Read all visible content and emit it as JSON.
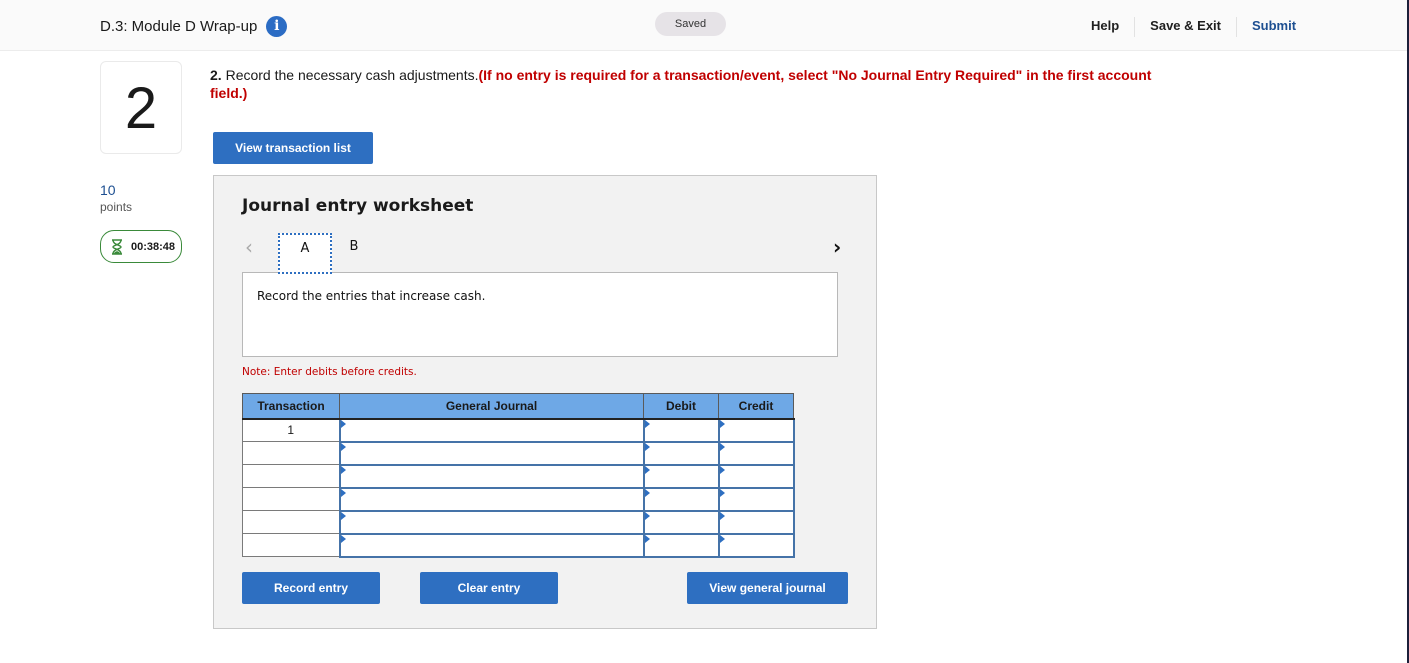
{
  "header": {
    "title": "D.3: Module D Wrap-up",
    "info_icon": "info-icon",
    "status": "Saved",
    "links": {
      "help": "Help",
      "save_exit": "Save & Exit",
      "submit": "Submit"
    }
  },
  "sidebar": {
    "question_number": "2",
    "points_value": "10",
    "points_label": "points",
    "timer": "00:38:48",
    "timer_icon": "hourglass-icon"
  },
  "question": {
    "number": "2.",
    "text": " Record the necessary cash adjustments.",
    "instruction": "(If no entry is required for a transaction/event, select \"No Journal Entry Required\" in the first account field.)"
  },
  "buttons": {
    "view_transaction_list": "View transaction list",
    "record_entry": "Record entry",
    "clear_entry": "Clear entry",
    "view_general_journal": "View general journal"
  },
  "worksheet": {
    "title": "Journal entry worksheet",
    "prev_icon": "‹",
    "next_icon": "›",
    "tabs": [
      {
        "label": "A",
        "active": true
      },
      {
        "label": "B",
        "active": false
      }
    ],
    "description": "Record the entries that increase cash.",
    "note": "Note: Enter debits before credits.",
    "table": {
      "columns": [
        "Transaction",
        "General Journal",
        "Debit",
        "Credit"
      ],
      "rows": [
        {
          "transaction": "1",
          "account": "",
          "debit": "",
          "credit": ""
        },
        {
          "transaction": "",
          "account": "",
          "debit": "",
          "credit": ""
        },
        {
          "transaction": "",
          "account": "",
          "debit": "",
          "credit": ""
        },
        {
          "transaction": "",
          "account": "",
          "debit": "",
          "credit": ""
        },
        {
          "transaction": "",
          "account": "",
          "debit": "",
          "credit": ""
        },
        {
          "transaction": "",
          "account": "",
          "debit": "",
          "credit": ""
        }
      ]
    }
  }
}
